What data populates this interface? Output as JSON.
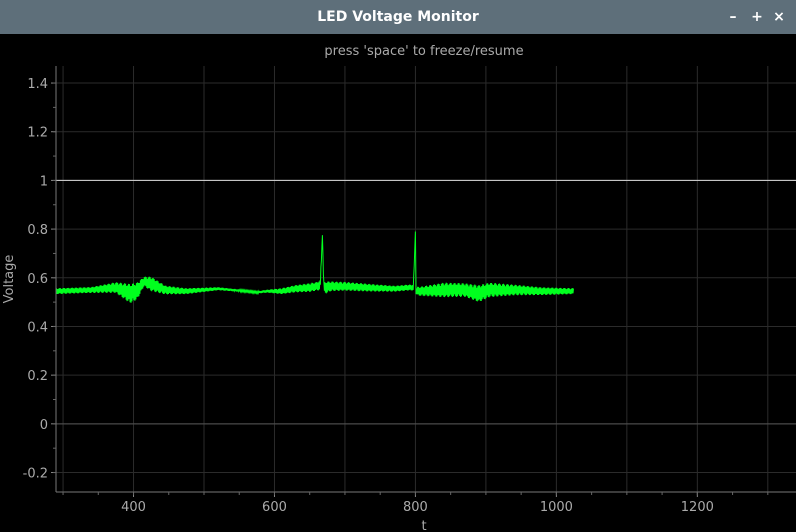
{
  "window": {
    "title": "LED Voltage Monitor",
    "buttons": {
      "minimize": "–",
      "maximize": "+",
      "close": "×"
    }
  },
  "plot": {
    "subtitle": "press 'space' to freeze/resume",
    "colors": {
      "background": "#000000",
      "grid": "#2b2b2b",
      "axis_text": "#aaaaaa",
      "signal": "#00ff1e",
      "reference": "#dddddd"
    }
  },
  "chart_data": {
    "type": "line",
    "title": "press 'space' to freeze/resume",
    "xlabel": "t",
    "ylabel": "Voltage",
    "xlim": [
      290,
      1340
    ],
    "ylim": [
      -0.28,
      1.47
    ],
    "xticks": [
      400,
      600,
      800,
      1000,
      1200
    ],
    "yticks": [
      -0.2,
      0,
      0.2,
      0.4,
      0.6,
      0.8,
      1,
      1.2,
      1.4
    ],
    "reference_lines": [
      {
        "y": 1.0
      },
      {
        "y": 0.0
      }
    ],
    "grid": true,
    "series": [
      {
        "x": [
          290,
          340,
          375,
          395,
          405,
          415,
          425,
          445,
          475,
          520,
          560,
          575,
          590,
          610,
          630,
          650,
          660,
          665,
          668,
          670,
          673,
          680,
          700,
          730,
          770,
          790,
          797,
          800,
          801,
          803,
          810,
          840,
          870,
          890,
          905,
          940,
          980,
          1025
        ],
        "y_center": [
          0.545,
          0.55,
          0.56,
          0.535,
          0.545,
          0.585,
          0.575,
          0.55,
          0.545,
          0.555,
          0.545,
          0.54,
          0.545,
          0.545,
          0.555,
          0.56,
          0.565,
          0.57,
          0.775,
          0.56,
          0.56,
          0.565,
          0.565,
          0.56,
          0.555,
          0.56,
          0.56,
          0.79,
          0.545,
          0.545,
          0.545,
          0.55,
          0.55,
          0.535,
          0.55,
          0.55,
          0.545,
          0.545
        ],
        "y_amplitude": [
          0.012,
          0.012,
          0.022,
          0.04,
          0.035,
          0.02,
          0.03,
          0.018,
          0.012,
          0.006,
          0.004,
          0.004,
          0.006,
          0.012,
          0.015,
          0.018,
          0.018,
          0.02,
          0.0,
          0.02,
          0.025,
          0.02,
          0.018,
          0.016,
          0.012,
          0.012,
          0.012,
          0.0,
          0.012,
          0.018,
          0.02,
          0.03,
          0.028,
          0.035,
          0.03,
          0.022,
          0.016,
          0.012
        ]
      }
    ]
  }
}
